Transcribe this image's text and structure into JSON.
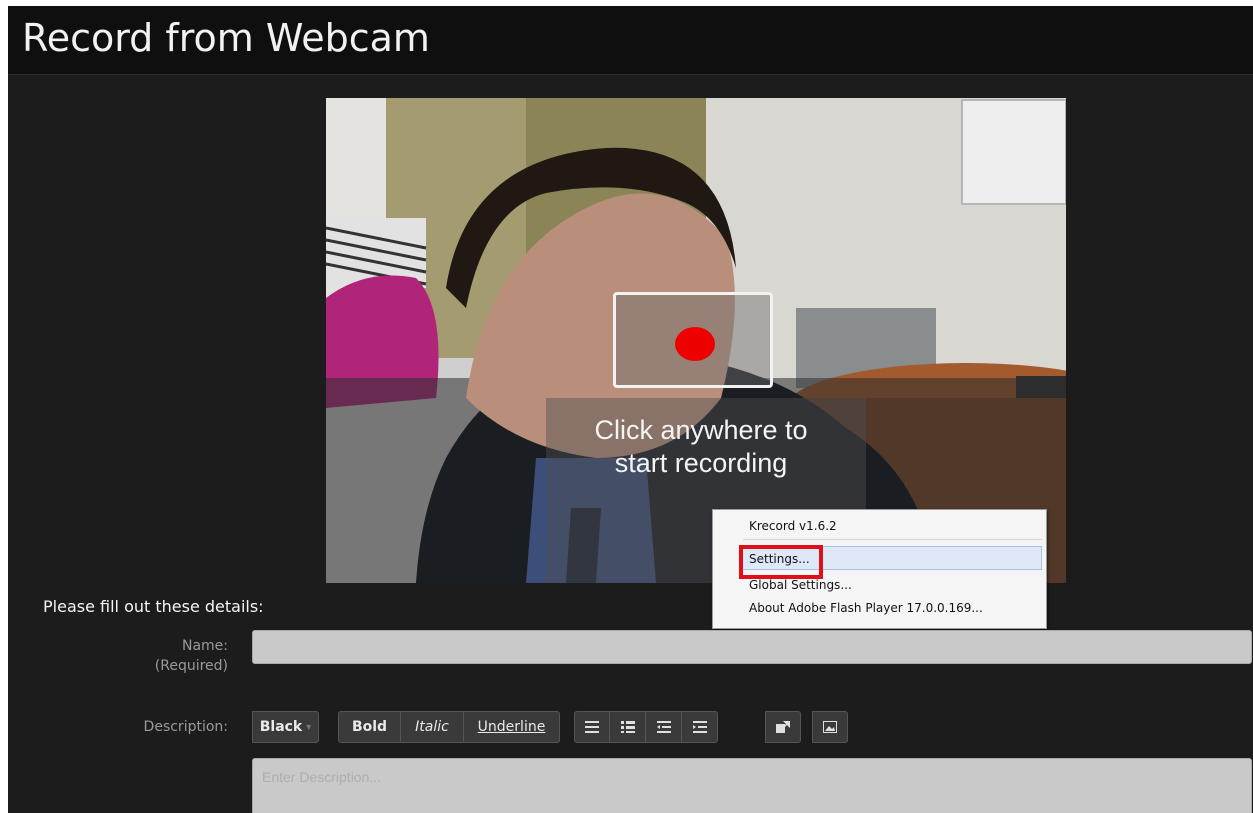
{
  "page": {
    "title": "Record from Webcam"
  },
  "video": {
    "prompt_line1": "Click anywhere to",
    "prompt_line2": "start recording",
    "icon": "record-icon",
    "record_color": "#ee0000"
  },
  "context_menu": {
    "header": "Krecord v1.6.2",
    "items": [
      "Settings...",
      "Global Settings...",
      "About Adobe Flash Player 17.0.0.169..."
    ],
    "highlight_color": "#e0101a"
  },
  "form": {
    "section_title": "Please fill out these details:",
    "name_label": "Name:",
    "name_required": "(Required)",
    "name_value": "",
    "description_label": "Description:",
    "description_placeholder": "Enter Description..."
  },
  "toolbar": {
    "color_label": "Black",
    "bold_label": "Bold",
    "italic_label": "Italic",
    "underline_label": "Underline",
    "icons": [
      "unordered-list-icon",
      "ordered-list-icon",
      "outdent-icon",
      "indent-icon",
      "link-icon",
      "image-icon"
    ]
  }
}
